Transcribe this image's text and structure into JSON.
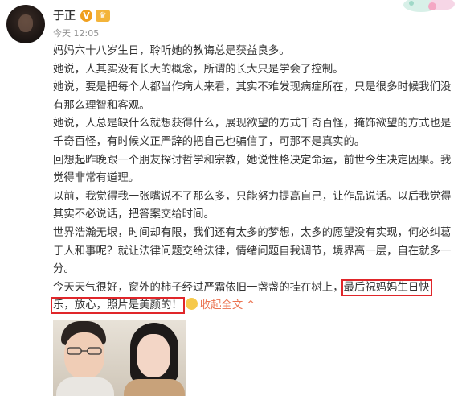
{
  "post": {
    "username": "于正",
    "verified_badge": "V",
    "timestamp": "今天 12:05",
    "paragraphs": [
      "妈妈六十八岁生日，聆听她的教诲总是获益良多。",
      "她说，人其实没有长大的概念，所谓的长大只是学会了控制。",
      "她说，要是把每个人都当作病人来看，其实不难发现病症所在，只是很多时候我们没有那么理智和客观。",
      "她说，人总是缺什么就想获得什么，展现欲望的方式千奇百怪，掩饰欲望的方式也是千奇百怪，有时候义正严辞的把自己也骗信了，可那不是真实的。",
      "回想起昨晚跟一个朋友探讨哲学和宗教，她说性格决定命运，前世今生决定因果。我觉得非常有道理。",
      "以前，我觉得我一张嘴说不了那么多，只能努力提高自己，让作品说话。以后我觉得其实不必说话，把答案交给时间。",
      "世界浩瀚无垠，时间却有限，我们还有太多的梦想，太多的愿望没有实现，何必纠葛于人和事呢？就让法律问题交给法律，情绪问题自我调节，境界高一层，自在就多一分。"
    ],
    "last_paragraph": {
      "before": "今天天气很好，窗外的柿子经过严霜依旧一盏盏的挂在树上，",
      "highlight_1": "最后祝妈妈生日快",
      "highlight_2": "乐，放心，照片是美颜的！"
    },
    "collapse_label": "收起全文",
    "collapse_arrow": "^"
  },
  "icons": {
    "verified": "verified-v-icon",
    "member": "crown-badge-icon",
    "emoji": "smile-emoji-icon",
    "chevron": "chevron-up-icon"
  },
  "colors": {
    "link": "#eb7350",
    "highlight_border": "#e0262a",
    "timestamp": "#939393"
  }
}
